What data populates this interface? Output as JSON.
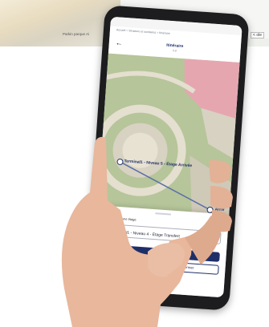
{
  "background_screen": {
    "caption": "Parkin parque Ai",
    "tag": "< ole"
  },
  "app": {
    "breadcrumb": "Accueil > Structure et sanitaires > Itinéraire",
    "title": "Itinéraire",
    "subtitle": "4.9",
    "map": {
      "start_label": "Terminal1 - Niveau 5 - Étage Arrivée",
      "end_label": "Arriv"
    },
    "sheet": {
      "prompt_label": "Sélectionner une étage",
      "select_caption": "Niveau",
      "select_value": "2 - Terminal1 - Niveau 4 - Étage Transfert",
      "select_chevron": "▾",
      "secondary_button_label": "Fermer"
    }
  },
  "colors": {
    "brand_navy": "#1e2f68",
    "map_green": "#b6c59a",
    "map_pink": "#e6a6b0",
    "route_line": "#5a6fa8"
  }
}
